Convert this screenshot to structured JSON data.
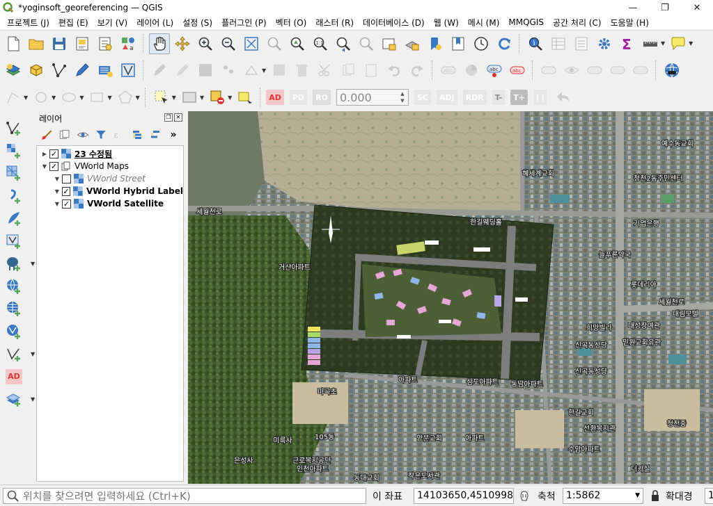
{
  "window": {
    "title": "*yoginsoft_georeferencing — QGIS",
    "minimize": "—",
    "maximize": "❐",
    "close": "✕"
  },
  "menus": [
    "프로젝트 (J)",
    "편집 (E)",
    "보기 (V)",
    "레이어 (L)",
    "설정 (S)",
    "플러그인 (P)",
    "벡터 (O)",
    "래스터 (R)",
    "데이터베이스 (D)",
    "웹 (W)",
    "메시 (M)",
    "MMQGIS",
    "공간 처리 (C)",
    "도움말 (H)"
  ],
  "digitizing": {
    "ad_label": "AD",
    "pd_label": "PD",
    "ro_label": "RO",
    "value": "0.000",
    "sc_label": "SC",
    "adj_label": "ADJ",
    "rdr_label": "RDR",
    "tminus_label": "T-",
    "tplus_label": "T+",
    "pause_label": "| |"
  },
  "left_toolbar": {
    "ad_label": "AD"
  },
  "layers_panel": {
    "title": "레이어",
    "layers": [
      {
        "name": "23 수정됨",
        "checked": true,
        "expanded": false,
        "indent": 0,
        "style": "bold-underline"
      },
      {
        "name": "VWorld Maps",
        "checked": true,
        "expanded": true,
        "indent": 0,
        "style": "group"
      },
      {
        "name": "VWorld Street",
        "checked": false,
        "expanded": true,
        "indent": 1,
        "style": "italic"
      },
      {
        "name": "VWorld Hybrid Label",
        "checked": true,
        "expanded": true,
        "indent": 1,
        "style": "bold"
      },
      {
        "name": "VWorld Satellite",
        "checked": true,
        "expanded": true,
        "indent": 1,
        "style": "bold"
      }
    ]
  },
  "map_labels": {
    "l1": "예수동교회",
    "l2": "청천2동주민센터",
    "l3": "혜세계교회",
    "l4": "세월천로",
    "l5": "한길웨딩홀",
    "l6": "기업은행",
    "l7": "거산아파트",
    "l8": "늘푸른약국",
    "l9": "롯데리아",
    "l10": "세월천로",
    "l11": "대림모텔",
    "l12": "희망빌라",
    "l13": "대성장여관",
    "l14": "신곡동성당",
    "l15": "믿원교회유관",
    "l16": "아파트",
    "l17": "삼도아파트",
    "l18": "동남아파트",
    "l19": "신곡동성당",
    "l20": "마곡초",
    "l21": "한길교회",
    "l22": "선환복지관",
    "l23": "청천중",
    "l24": "미륵사",
    "l25": "105동",
    "l26": "양문교회",
    "l27": "아파트",
    "l28": "수암아파트",
    "l29": "은성사",
    "l30": "근로복지공단",
    "l31": "인천아파트",
    "l32": "동대교회",
    "l33": "작은도서관",
    "l34": "더카실"
  },
  "statusbar": {
    "locator_placeholder": "위치를 찾으려면 입력하세요 (Ctrl+K)",
    "coord_label": "이 좌표",
    "coord_value": "14103650,4510998",
    "scale_label": "축척",
    "scale_value": "1:5862",
    "magnifier_label": "확대경",
    "magnifier_value": "1"
  },
  "colors": {
    "accent_blue": "#3a78c3",
    "qgis_green": "#589632",
    "ad_red": "#e03030"
  }
}
